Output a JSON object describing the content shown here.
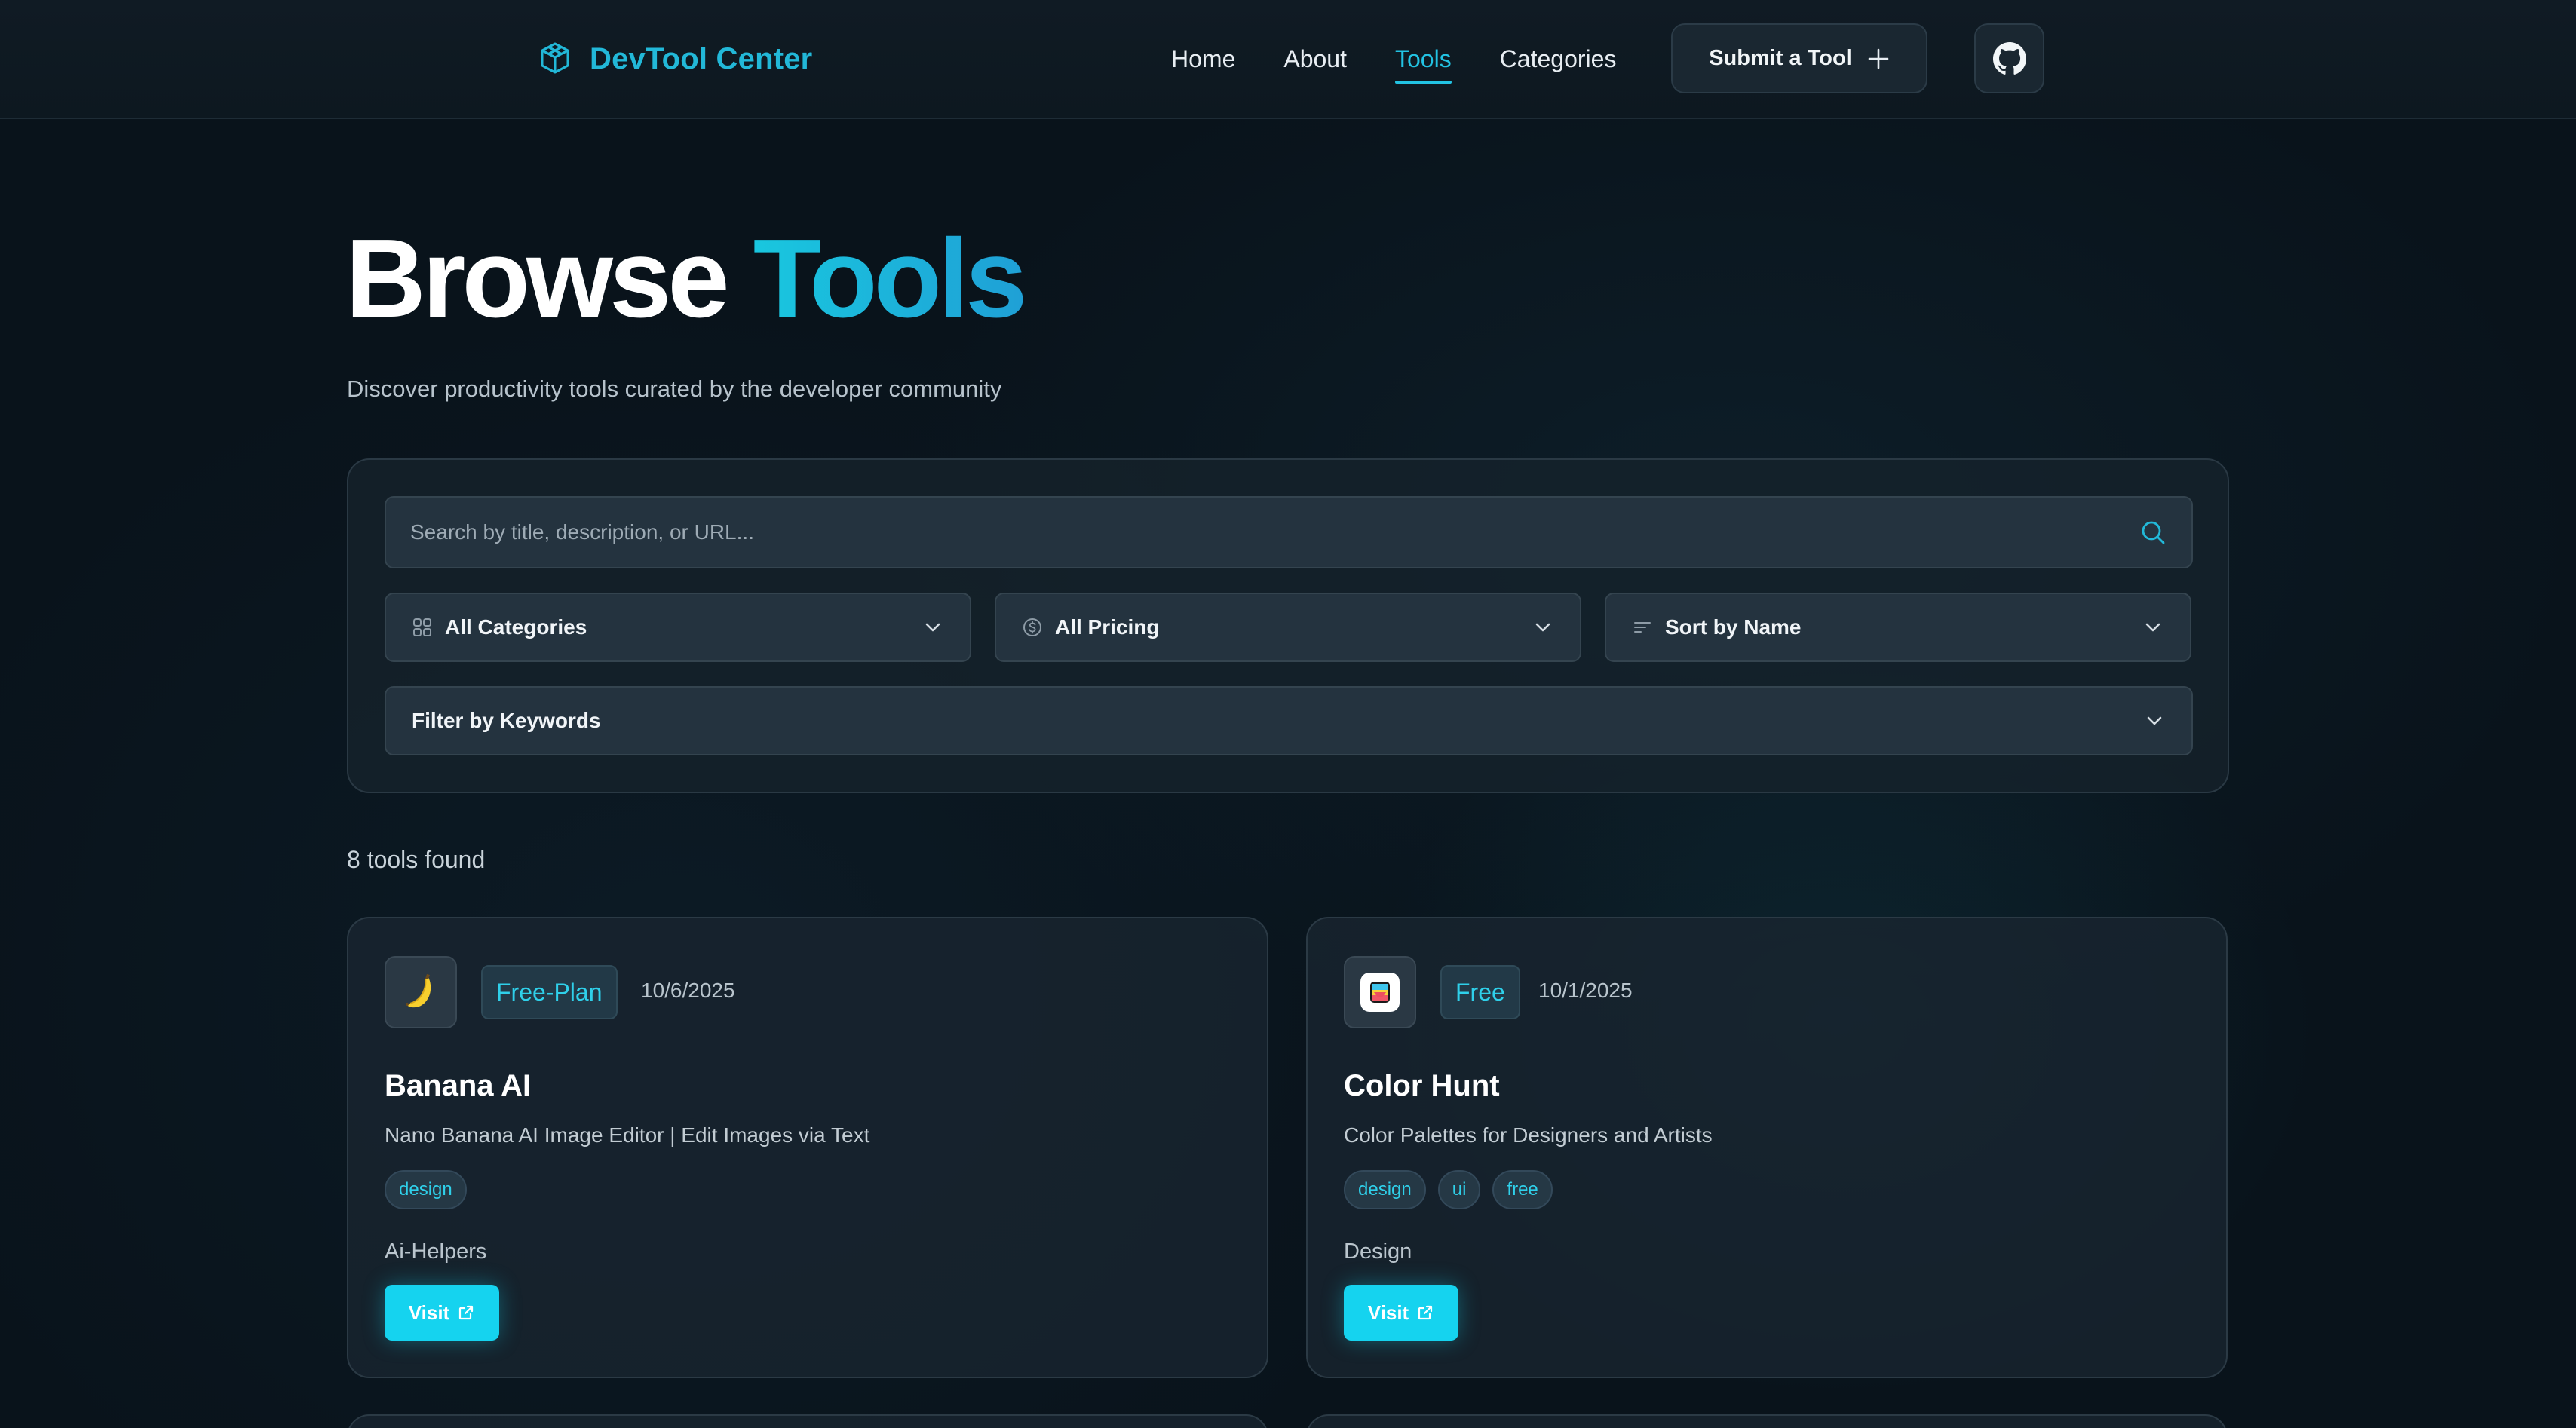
{
  "brand": {
    "name": "DevTool Center",
    "icon": "cube-icon"
  },
  "nav": {
    "items": [
      {
        "label": "Home"
      },
      {
        "label": "About"
      },
      {
        "label": "Tools",
        "active": true
      },
      {
        "label": "Categories"
      }
    ],
    "submit_label": "Submit a Tool",
    "github_icon": "github-icon"
  },
  "hero": {
    "title_main": "Browse",
    "title_accent": "Tools",
    "subtitle": "Discover productivity tools curated by the developer community"
  },
  "filters": {
    "search_placeholder": "Search by title, description, or URL...",
    "category": "All Categories",
    "pricing": "All Pricing",
    "sort": "Sort by Name",
    "keywords": "Filter by Keywords"
  },
  "results": {
    "count_text": "8 tools found"
  },
  "tools": [
    {
      "title": "Banana AI",
      "pricing": "Free-Plan",
      "date": "10/6/2025",
      "description": "Nano Banana AI Image Editor | Edit Images via Text",
      "tags": [
        "design"
      ],
      "category": "Ai-Helpers",
      "visit_label": "Visit",
      "logo": "banana-icon"
    },
    {
      "title": "Color Hunt",
      "pricing": "Free",
      "date": "10/1/2025",
      "description": "Color Palettes for Designers and Artists",
      "tags": [
        "design",
        "ui",
        "free"
      ],
      "category": "Design",
      "visit_label": "Visit",
      "logo": "color-hunt-logo-icon"
    }
  ],
  "colors": {
    "accent": "#22b8d8",
    "button": "#15d3ef",
    "background": "#09131b"
  }
}
